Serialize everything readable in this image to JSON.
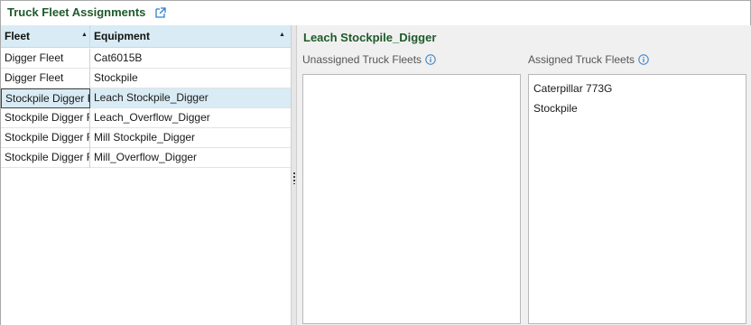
{
  "header": {
    "title": "Truck Fleet Assignments"
  },
  "grid": {
    "columns": {
      "fleet": "Fleet",
      "equipment": "Equipment"
    },
    "rows": [
      {
        "fleet": "Digger Fleet",
        "equipment": "Cat6015B"
      },
      {
        "fleet": "Digger Fleet",
        "equipment": "Stockpile"
      },
      {
        "fleet": "Stockpile Digger Fleet",
        "equipment": "Leach Stockpile_Digger"
      },
      {
        "fleet": "Stockpile Digger Fleet",
        "equipment": "Leach_Overflow_Digger"
      },
      {
        "fleet": "Stockpile Digger Fleet",
        "equipment": "Mill Stockpile_Digger"
      },
      {
        "fleet": "Stockpile Digger Fleet",
        "equipment": "Mill_Overflow_Digger"
      }
    ],
    "selected_index": 2
  },
  "detail": {
    "title": "Leach Stockpile_Digger",
    "unassigned_label": "Unassigned Truck Fleets",
    "assigned_label": "Assigned Truck Fleets",
    "unassigned_items": [],
    "assigned_items": [
      "Caterpillar 773G",
      "Stockpile"
    ]
  },
  "colors": {
    "accent_title": "#1f5a2a",
    "header_bg": "#d9ebf4",
    "info_icon": "#2f7ec9"
  }
}
